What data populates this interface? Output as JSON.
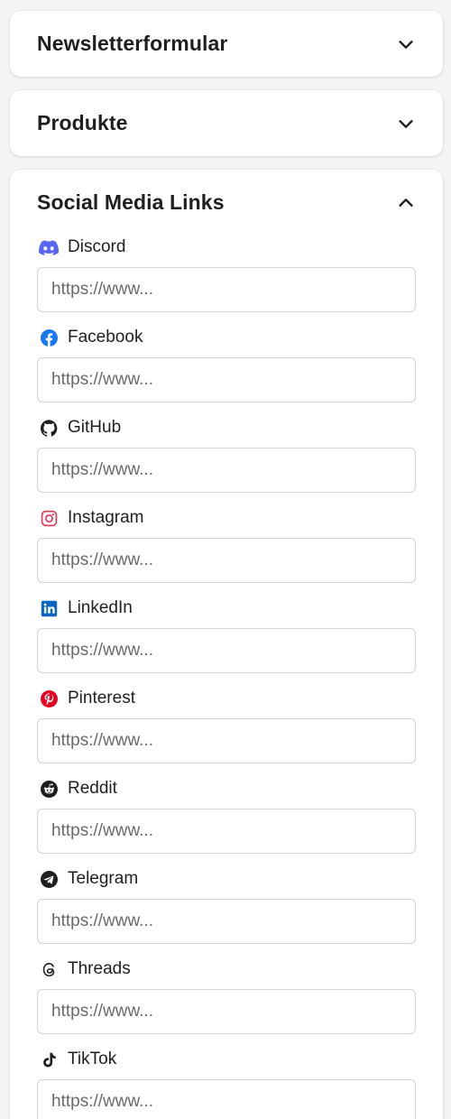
{
  "sections": {
    "newsletter": {
      "title": "Newsletterformular",
      "expanded": false
    },
    "products": {
      "title": "Produkte",
      "expanded": false
    },
    "social": {
      "title": "Social Media Links",
      "expanded": true,
      "placeholder": "https://www...",
      "links": [
        {
          "label": "Discord",
          "icon": "discord-icon",
          "color": "#5865F2"
        },
        {
          "label": "Facebook",
          "icon": "facebook-icon",
          "color": "#1877F2"
        },
        {
          "label": "GitHub",
          "icon": "github-icon",
          "color": "#1f1f1f"
        },
        {
          "label": "Instagram",
          "icon": "instagram-icon",
          "color": "#E4405F"
        },
        {
          "label": "LinkedIn",
          "icon": "linkedin-icon",
          "color": "#0A66C2"
        },
        {
          "label": "Pinterest",
          "icon": "pinterest-icon",
          "color": "#E60023"
        },
        {
          "label": "Reddit",
          "icon": "reddit-icon",
          "color": "#1f1f1f"
        },
        {
          "label": "Telegram",
          "icon": "telegram-icon",
          "color": "#1f1f1f"
        },
        {
          "label": "Threads",
          "icon": "threads-icon",
          "color": "#1f1f1f"
        },
        {
          "label": "TikTok",
          "icon": "tiktok-icon",
          "color": "#1f1f1f"
        }
      ]
    }
  }
}
